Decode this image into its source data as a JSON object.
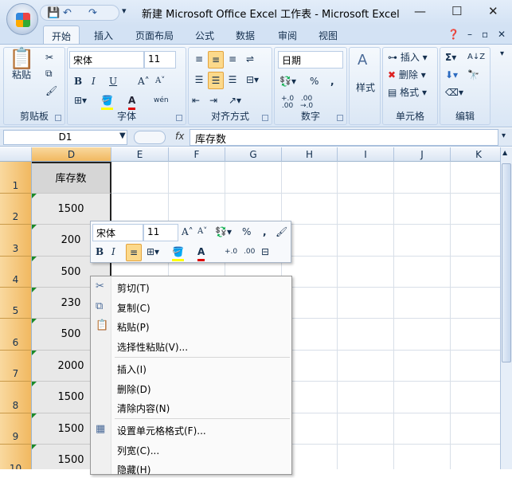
{
  "window": {
    "title": "新建 Microsoft Office Excel 工作表 - Microsoft Excel",
    "minimize": "—",
    "maximize": "☐",
    "close": "✕"
  },
  "qat": {
    "save": "💾",
    "undo": "↶",
    "redo": "↷",
    "customize": "₹"
  },
  "tabs": [
    "开始",
    "插入",
    "页面布局",
    "公式",
    "数据",
    "审阅",
    "视图"
  ],
  "ribbon": {
    "clipboard": {
      "label": "剪贴板",
      "paste": "粘贴"
    },
    "font": {
      "label": "字体",
      "name": "宋体",
      "size": "11",
      "bold": "B",
      "italic": "I",
      "underline": "U",
      "grow": "A˄",
      "shrink": "A˅",
      "fontcolor": "A",
      "phonetic": "wén"
    },
    "alignment": {
      "label": "对齐方式"
    },
    "number": {
      "label": "数字",
      "format": "日期",
      "percent": "%",
      "comma": ",",
      "inc": "+.0\n.00",
      "dec": ".00\n→.0"
    },
    "styles": {
      "label": "样式"
    },
    "cells": {
      "label": "单元格",
      "insert": "插入",
      "delete": "删除",
      "format": "格式"
    },
    "editing": {
      "label": "编辑",
      "sum": "Σ",
      "sort": "A↓Z"
    }
  },
  "formula_bar": {
    "name_box": "D1",
    "fx": "fx",
    "content": "库存数"
  },
  "columns": [
    "D",
    "E",
    "F",
    "G",
    "H",
    "I",
    "J",
    "K"
  ],
  "rows": [
    {
      "n": "1",
      "d": "库存数"
    },
    {
      "n": "2",
      "d": "1500"
    },
    {
      "n": "3",
      "d": "200"
    },
    {
      "n": "4",
      "d": "500"
    },
    {
      "n": "5",
      "d": "230"
    },
    {
      "n": "6",
      "d": "500"
    },
    {
      "n": "7",
      "d": "2000"
    },
    {
      "n": "8",
      "d": "1500"
    },
    {
      "n": "9",
      "d": "1500"
    },
    {
      "n": "10",
      "d": "1500"
    }
  ],
  "mini_toolbar": {
    "font": "宋体",
    "size": "11",
    "bold": "B",
    "italic": "I",
    "percent": "%",
    "comma": ",",
    "fontcolor": "A",
    "inc": "+.0",
    "dec": ".00"
  },
  "context_menu": [
    {
      "label": "剪切(T)",
      "icon": "scissors-icon",
      "glyph": "✂"
    },
    {
      "label": "复制(C)",
      "icon": "copy-icon",
      "glyph": "⧉"
    },
    {
      "label": "粘贴(P)",
      "icon": "paste-icon",
      "glyph": "📋"
    },
    {
      "label": "选择性粘贴(V)...",
      "sep_after": true
    },
    {
      "label": "插入(I)"
    },
    {
      "label": "删除(D)"
    },
    {
      "label": "清除内容(N)",
      "sep_after": true
    },
    {
      "label": "设置单元格格式(F)...",
      "icon": "format-cells-icon",
      "glyph": "▦"
    },
    {
      "label": "列宽(C)..."
    },
    {
      "label": "隐藏(H)"
    }
  ]
}
